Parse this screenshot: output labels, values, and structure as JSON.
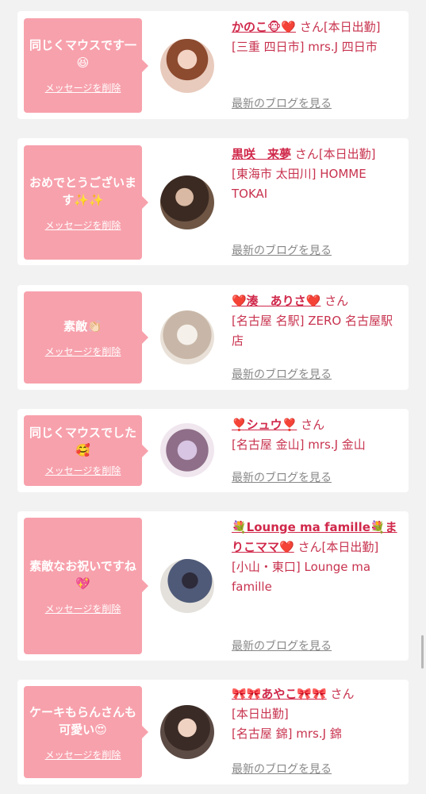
{
  "delete_label": "メッセージを削除",
  "blog_label": "最新のブログを見る",
  "san_label": "さん",
  "colors": {
    "accent": "#f7a1ac",
    "name": "#d0284a",
    "text": "#c8334f",
    "link": "#888888"
  },
  "messages": [
    {
      "message": "同じくマウスです一😆",
      "name": "かのこ🐵❤️",
      "status": "[本日出勤]",
      "shop": "[三重 四日市] mrs.J 四日市",
      "avatar_icon": "avatar-photo-woman"
    },
    {
      "message": "おめでとうございます✨✨",
      "name": "黒咲　来夢",
      "status": "[本日出勤]",
      "shop": "[東海市 太田川] HOMME TOKAI",
      "avatar_icon": "avatar-photo-woman"
    },
    {
      "message": "素敵👏🏻",
      "name": "❤️湊　ありさ❤️",
      "status": "",
      "shop": "[名古屋 名駅] ZERO 名古屋駅店",
      "avatar_icon": "avatar-photo-woman"
    },
    {
      "message": "同じくマウスでした🥰",
      "name": "❣️シュウ❣️",
      "status": "",
      "shop": "[名古屋 金山] mrs.J 金山",
      "avatar_icon": "avatar-photo-woman"
    },
    {
      "message": "素敵なお祝いですね💖",
      "name": "💐Lounge ma famille💐まりこママ❤️",
      "status": "[本日出勤]",
      "shop": "[小山・東口] Lounge ma famille",
      "avatar_icon": "avatar-photo-woman"
    },
    {
      "message": "ケーキもらんさんも可愛い😍",
      "name": "🎀🎀あやこ🎀🎀",
      "status": "[本日出勤]",
      "shop": "[名古屋 錦] mrs.J 錦",
      "avatar_icon": "avatar-photo-woman"
    }
  ]
}
